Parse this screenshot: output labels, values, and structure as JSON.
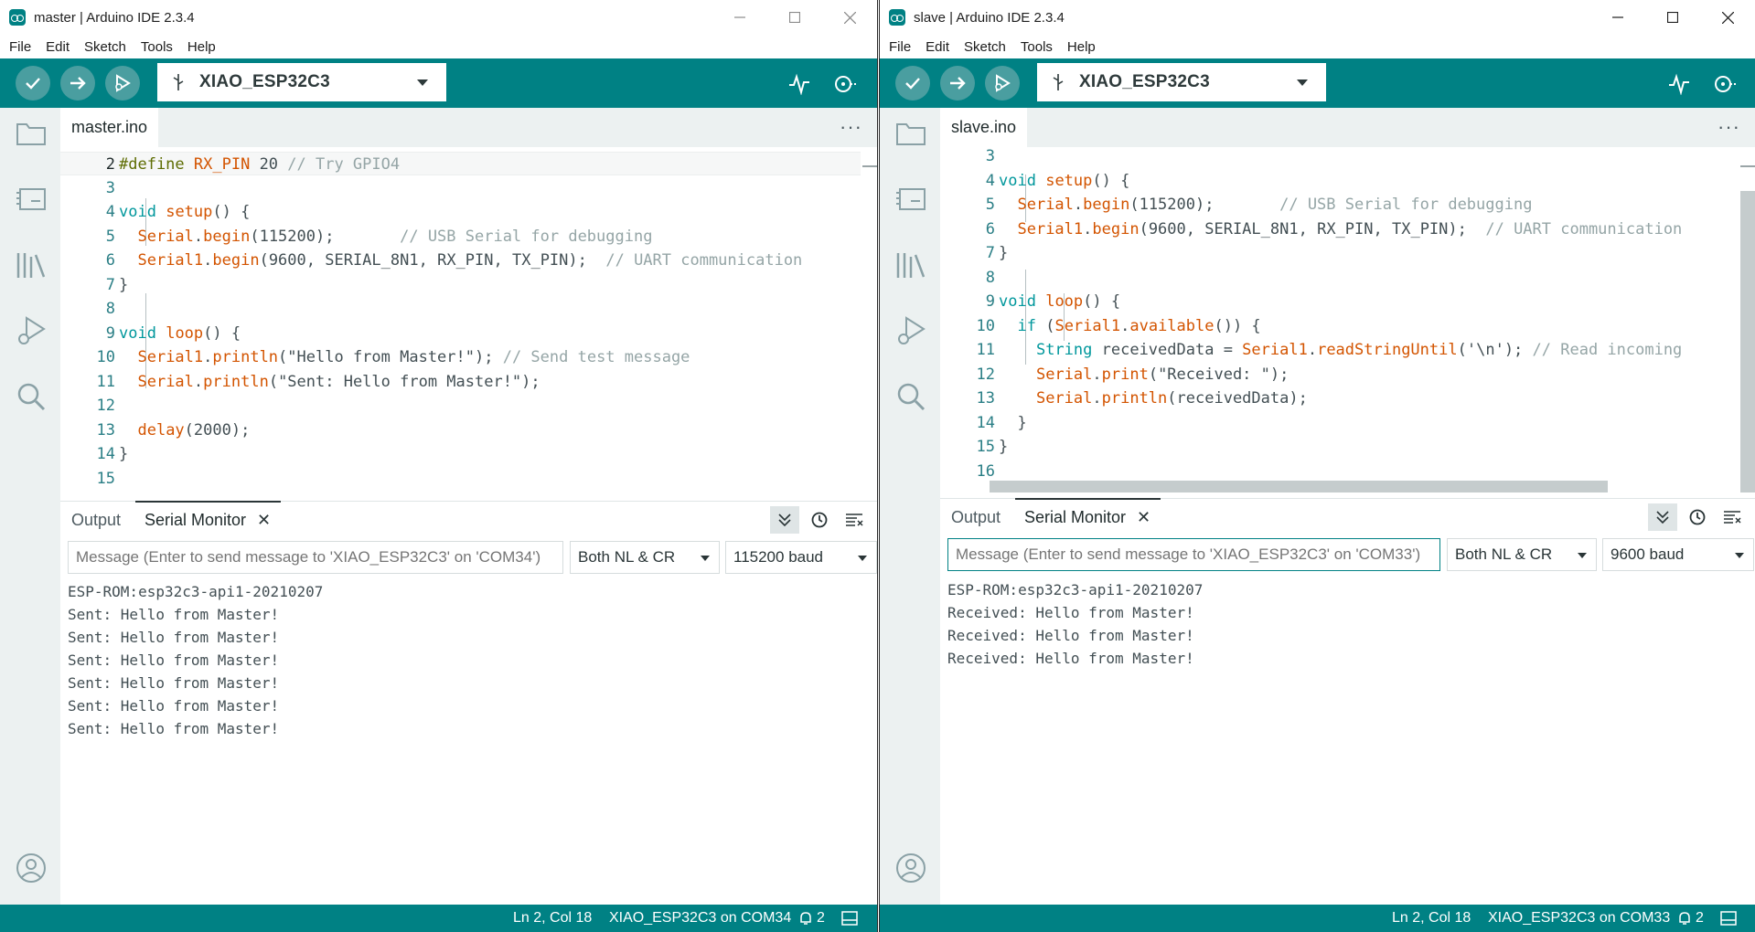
{
  "menu": [
    "File",
    "Edit",
    "Sketch",
    "Tools",
    "Help"
  ],
  "colors": {
    "accent": "#008184",
    "keyword": "#00979c",
    "function": "#d35400",
    "preprocessor": "#5e6d03",
    "comment": "#95a5a6"
  },
  "icons": {
    "toolbar": [
      "verify-icon",
      "upload-icon",
      "debug-icon"
    ],
    "toolbar_right": [
      "serial-plotter-icon",
      "serial-monitor-icon"
    ],
    "sidebar": [
      "sketchbook-folder-icon",
      "boards-manager-icon",
      "library-manager-icon",
      "debug-icon",
      "search-icon",
      "profile-icon"
    ]
  },
  "left": {
    "title": "master | Arduino IDE 2.3.4",
    "board": "XIAO_ESP32C3",
    "tab": "master.ino",
    "code": [
      {
        "ln": "2",
        "text": "#define RX_PIN 20 // Try GPIO4"
      },
      {
        "ln": "3",
        "text": ""
      },
      {
        "ln": "4",
        "text": "void setup() {"
      },
      {
        "ln": "5",
        "text": "  Serial.begin(115200);       // USB Serial for debugging"
      },
      {
        "ln": "6",
        "text": "  Serial1.begin(9600, SERIAL_8N1, RX_PIN, TX_PIN);  // UART communication"
      },
      {
        "ln": "7",
        "text": "}"
      },
      {
        "ln": "8",
        "text": ""
      },
      {
        "ln": "9",
        "text": "void loop() {"
      },
      {
        "ln": "10",
        "text": "  Serial1.println(\"Hello from Master!\"); // Send test message"
      },
      {
        "ln": "11",
        "text": "  Serial.println(\"Sent: Hello from Master!\");"
      },
      {
        "ln": "12",
        "text": ""
      },
      {
        "ln": "13",
        "text": "  delay(2000);"
      },
      {
        "ln": "14",
        "text": "}"
      },
      {
        "ln": "15",
        "text": ""
      }
    ],
    "panel": {
      "tab_output": "Output",
      "tab_serial": "Serial Monitor",
      "message_placeholder": "Message (Enter to send message to 'XIAO_ESP32C3' on 'COM34')",
      "line_ending": "Both NL & CR",
      "baud": "115200 baud",
      "output": [
        "ESP-ROM:esp32c3-api1-20210207",
        "Sent: Hello from Master!",
        "Sent: Hello from Master!",
        "Sent: Hello from Master!",
        "Sent: Hello from Master!",
        "Sent: Hello from Master!",
        "Sent: Hello from Master!"
      ]
    },
    "status": {
      "position": "Ln 2, Col 18",
      "board_port": "XIAO_ESP32C3 on COM34",
      "notifications": "2"
    }
  },
  "right": {
    "title": "slave | Arduino IDE 2.3.4",
    "board": "XIAO_ESP32C3",
    "tab": "slave.ino",
    "code": [
      {
        "ln": "3",
        "text": ""
      },
      {
        "ln": "4",
        "text": "void setup() {"
      },
      {
        "ln": "5",
        "text": "  Serial.begin(115200);       // USB Serial for debugging"
      },
      {
        "ln": "6",
        "text": "  Serial1.begin(9600, SERIAL_8N1, RX_PIN, TX_PIN);  // UART communication"
      },
      {
        "ln": "7",
        "text": "}"
      },
      {
        "ln": "8",
        "text": ""
      },
      {
        "ln": "9",
        "text": "void loop() {"
      },
      {
        "ln": "10",
        "text": "  if (Serial1.available()) {"
      },
      {
        "ln": "11",
        "text": "    String receivedData = Serial1.readStringUntil('\\n'); // Read incoming"
      },
      {
        "ln": "12",
        "text": "    Serial.print(\"Received: \");"
      },
      {
        "ln": "13",
        "text": "    Serial.println(receivedData);"
      },
      {
        "ln": "14",
        "text": "  }"
      },
      {
        "ln": "15",
        "text": "}"
      },
      {
        "ln": "16",
        "text": ""
      }
    ],
    "panel": {
      "tab_output": "Output",
      "tab_serial": "Serial Monitor",
      "message_placeholder": "Message (Enter to send message to 'XIAO_ESP32C3' on 'COM33')",
      "line_ending": "Both NL & CR",
      "baud": "9600 baud",
      "output": [
        "ESP-ROM:esp32c3-api1-20210207",
        "Received: Hello from Master!",
        "Received: Hello from Master!",
        "Received: Hello from Master!"
      ]
    },
    "status": {
      "position": "Ln 2, Col 18",
      "board_port": "XIAO_ESP32C3 on COM33",
      "notifications": "2"
    }
  }
}
